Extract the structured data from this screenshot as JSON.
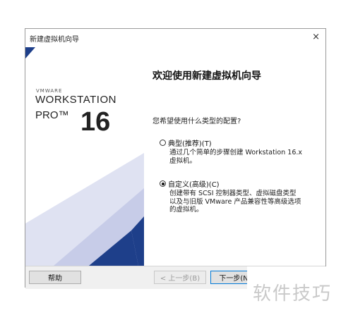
{
  "window": {
    "title": "新建虚拟机向导",
    "close_label": "×"
  },
  "brand": {
    "vendor": "VMWARE",
    "product": "WORKSTATION",
    "edition": "PRO™",
    "version": "16"
  },
  "main": {
    "heading": "欢迎使用新建虚拟机向导",
    "question": "您希望使用什么类型的配置?",
    "options": [
      {
        "label": "典型(推荐)(T)",
        "description": [
          "通过几个简单的步骤创建 Workstation 16.x",
          "虚拟机。"
        ],
        "selected": false
      },
      {
        "label": "自定义(高级)(C)",
        "description": [
          "创建带有 SCSI 控制器类型、虚拟磁盘类型",
          "以及与旧版 VMware 产品兼容性等高级选项",
          "的虚拟机。"
        ],
        "selected": true
      }
    ]
  },
  "footer": {
    "help_label": "帮助",
    "back_label": "< 上一步(B)",
    "next_label": "下一步(N)"
  },
  "watermark": {
    "text": "软件技巧"
  },
  "colors": {
    "accent_dark": "#1e3f8a",
    "accent_light": "#c7cce8",
    "focus": "#0078d7"
  }
}
